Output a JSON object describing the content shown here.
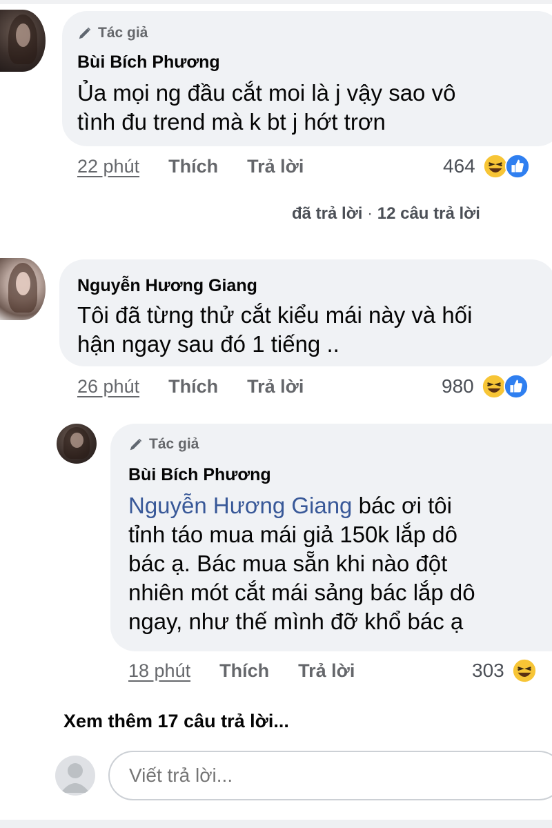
{
  "comments": [
    {
      "author_badge": "Tác giả",
      "name": "Bùi Bích Phương",
      "text_lines": [
        "Ủa mọi ng đầu cắt moi là j vậy sao vô",
        "tình đu trend mà k bt j hớt trơn"
      ],
      "time": "22 phút",
      "like": "Thích",
      "reply": "Trả lời",
      "reaction_count": "464",
      "reply_summary_action": "đã trả lời",
      "reply_summary_count": "12 câu trả lời"
    },
    {
      "name": "Nguyễn Hương Giang",
      "text_lines": [
        "Tôi đã từng thử cắt kiểu mái này và hối",
        "hận ngay sau đó 1 tiếng .."
      ],
      "time": "26 phút",
      "like": "Thích",
      "reply": "Trả lời",
      "reaction_count": "980"
    },
    {
      "author_badge": "Tác giả",
      "name": "Bùi Bích Phương",
      "mention": "Nguyễn Hương Giang",
      "text_first_after_mention": "bác ơi tôi",
      "text_lines": [
        "tỉnh táo mua mái giả 150k lắp dô",
        "bác ạ. Bác mua sẵn khi nào đột",
        "nhiên mót cắt mái sảng bác lắp dô",
        "ngay, như thế mình đỡ khổ bác ạ"
      ],
      "time": "18 phút",
      "like": "Thích",
      "reply": "Trả lời",
      "reaction_count": "303"
    }
  ],
  "more_replies": "Xem thêm 17 câu trả lời...",
  "composer": {
    "placeholder": "Viết trả lời..."
  },
  "colors": {
    "bubble": "#f0f2f5",
    "mention": "#385898",
    "secondary_text": "#65676b"
  },
  "icons": [
    "pen-icon",
    "haha-reaction-icon",
    "like-reaction-icon",
    "default-avatar-icon"
  ]
}
